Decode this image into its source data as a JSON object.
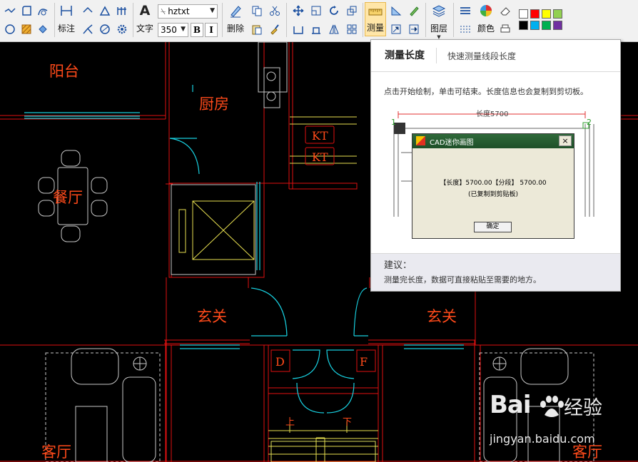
{
  "toolbar": {
    "mark_label": "标注",
    "text_label": "文字",
    "font_name": "hztxt",
    "font_size": "350",
    "bold_label": "B",
    "italic_label": "I",
    "delete_label": "删除",
    "measure_label": "测量",
    "layer_label": "图层",
    "color_label": "颜色",
    "palette": [
      "#ffffff",
      "#ff0000",
      "#ffff00",
      "#92d050",
      "#000000",
      "#00b0f0",
      "#00b050",
      "#7030a0"
    ]
  },
  "drawing": {
    "rooms": [
      "阳台",
      "厨房",
      "餐厅",
      "玄关",
      "玄关",
      "客厅",
      "客厅"
    ],
    "tags": [
      "KT",
      "KT",
      "D",
      "F"
    ],
    "stairs": [
      "上",
      "下"
    ]
  },
  "tooltip": {
    "title": "测量长度",
    "subtitle": "快速测量线段长度",
    "description": "点击开始绘制，单击可结束。长度信息也会复制到剪切板。",
    "preview": {
      "length_label": "长度5700",
      "point_1": "1",
      "point_2": "2",
      "dialog_title": "CAD迷你画图",
      "dialog_close": "×",
      "dialog_line1": "【长度】5700.00【分段】 5700.00",
      "dialog_line2": "(已复制到剪贴板)",
      "dialog_ok": "确定"
    },
    "suggestion_title": "建议：",
    "suggestion_text": "测量完长度，数据可直接粘贴至需要的地方。"
  },
  "watermark": {
    "brand": "Bai",
    "brand_cn": "经验",
    "url": "jingyan.baidu.com"
  }
}
